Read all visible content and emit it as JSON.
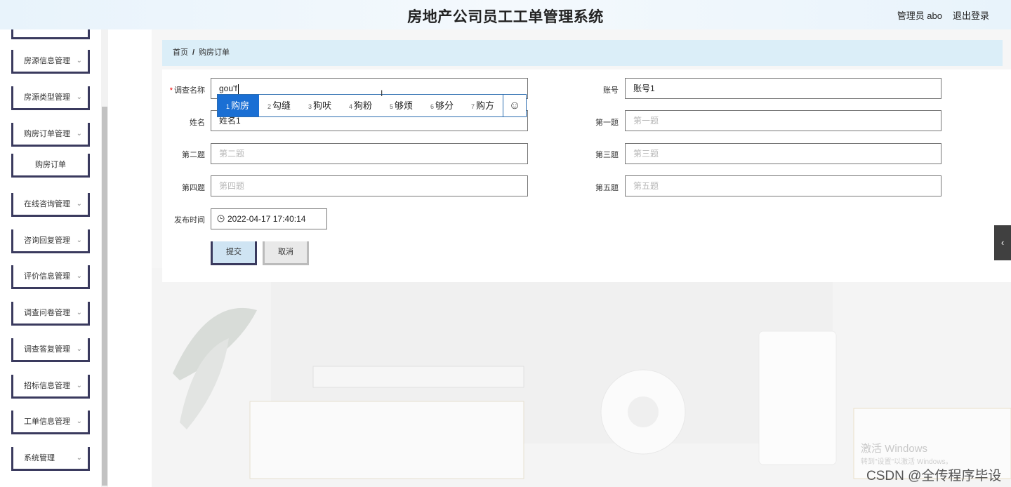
{
  "header": {
    "title": "房地产公司员工工单管理系统",
    "user": "管理员 abo",
    "logout": "退出登录"
  },
  "sidebar": {
    "items": [
      {
        "label": "房源信息管理",
        "chevron": "⌄"
      },
      {
        "label": "房源类型管理",
        "chevron": "⌄"
      },
      {
        "label": "购房订单管理",
        "chevron": "⌄"
      },
      {
        "label": "购房订单"
      },
      {
        "label": "在线咨询管理",
        "chevron": "⌄"
      },
      {
        "label": "咨询回复管理",
        "chevron": "⌄"
      },
      {
        "label": "评价信息管理",
        "chevron": "⌄"
      },
      {
        "label": "调查问卷管理",
        "chevron": "⌄"
      },
      {
        "label": "调查答复管理",
        "chevron": "⌄"
      },
      {
        "label": "招标信息管理",
        "chevron": "⌄"
      },
      {
        "label": "工单信息管理",
        "chevron": "⌄"
      },
      {
        "label": "系统管理",
        "chevron": "⌄"
      }
    ]
  },
  "breadcrumb": {
    "home": "首页",
    "separator": "/",
    "current": "购房订单"
  },
  "form": {
    "survey_name": {
      "label": "调查名称",
      "required_mark": "*",
      "value": "gou'f"
    },
    "account": {
      "label": "账号",
      "value": "账号1"
    },
    "name": {
      "label": "姓名",
      "value": "姓名1"
    },
    "q1": {
      "label": "第一题",
      "placeholder": "第一题"
    },
    "q2": {
      "label": "第二题",
      "placeholder": "第二题"
    },
    "q3": {
      "label": "第三题",
      "placeholder": "第三题"
    },
    "q4": {
      "label": "第四题",
      "placeholder": "第四题"
    },
    "q5": {
      "label": "第五题",
      "placeholder": "第五题"
    },
    "publish_time": {
      "label": "发布时间",
      "icon": "clock-icon",
      "value": "2022-04-17 17:40:14"
    },
    "submit": "提交",
    "cancel": "取消"
  },
  "ime": {
    "candidates": [
      {
        "n": "1",
        "text": "购房",
        "active": true
      },
      {
        "n": "2",
        "text": "勾缝"
      },
      {
        "n": "3",
        "text": "狗吠"
      },
      {
        "n": "4",
        "text": "狗粉"
      },
      {
        "n": "5",
        "text": "够烦"
      },
      {
        "n": "6",
        "text": "够分"
      },
      {
        "n": "7",
        "text": "购方"
      }
    ],
    "emoji_icon": "☺"
  },
  "side_tab_icon": "‹",
  "watermarks": {
    "activate_title": "激活 Windows",
    "activate_sub": "转到\"设置\"以激活 Windows。",
    "csdn": "CSDN @全传程序毕设"
  },
  "colors": {
    "accent": "#3a3a5e",
    "breadcrumb_bg": "#dbeef8",
    "ime_active": "#1a6fd4"
  }
}
